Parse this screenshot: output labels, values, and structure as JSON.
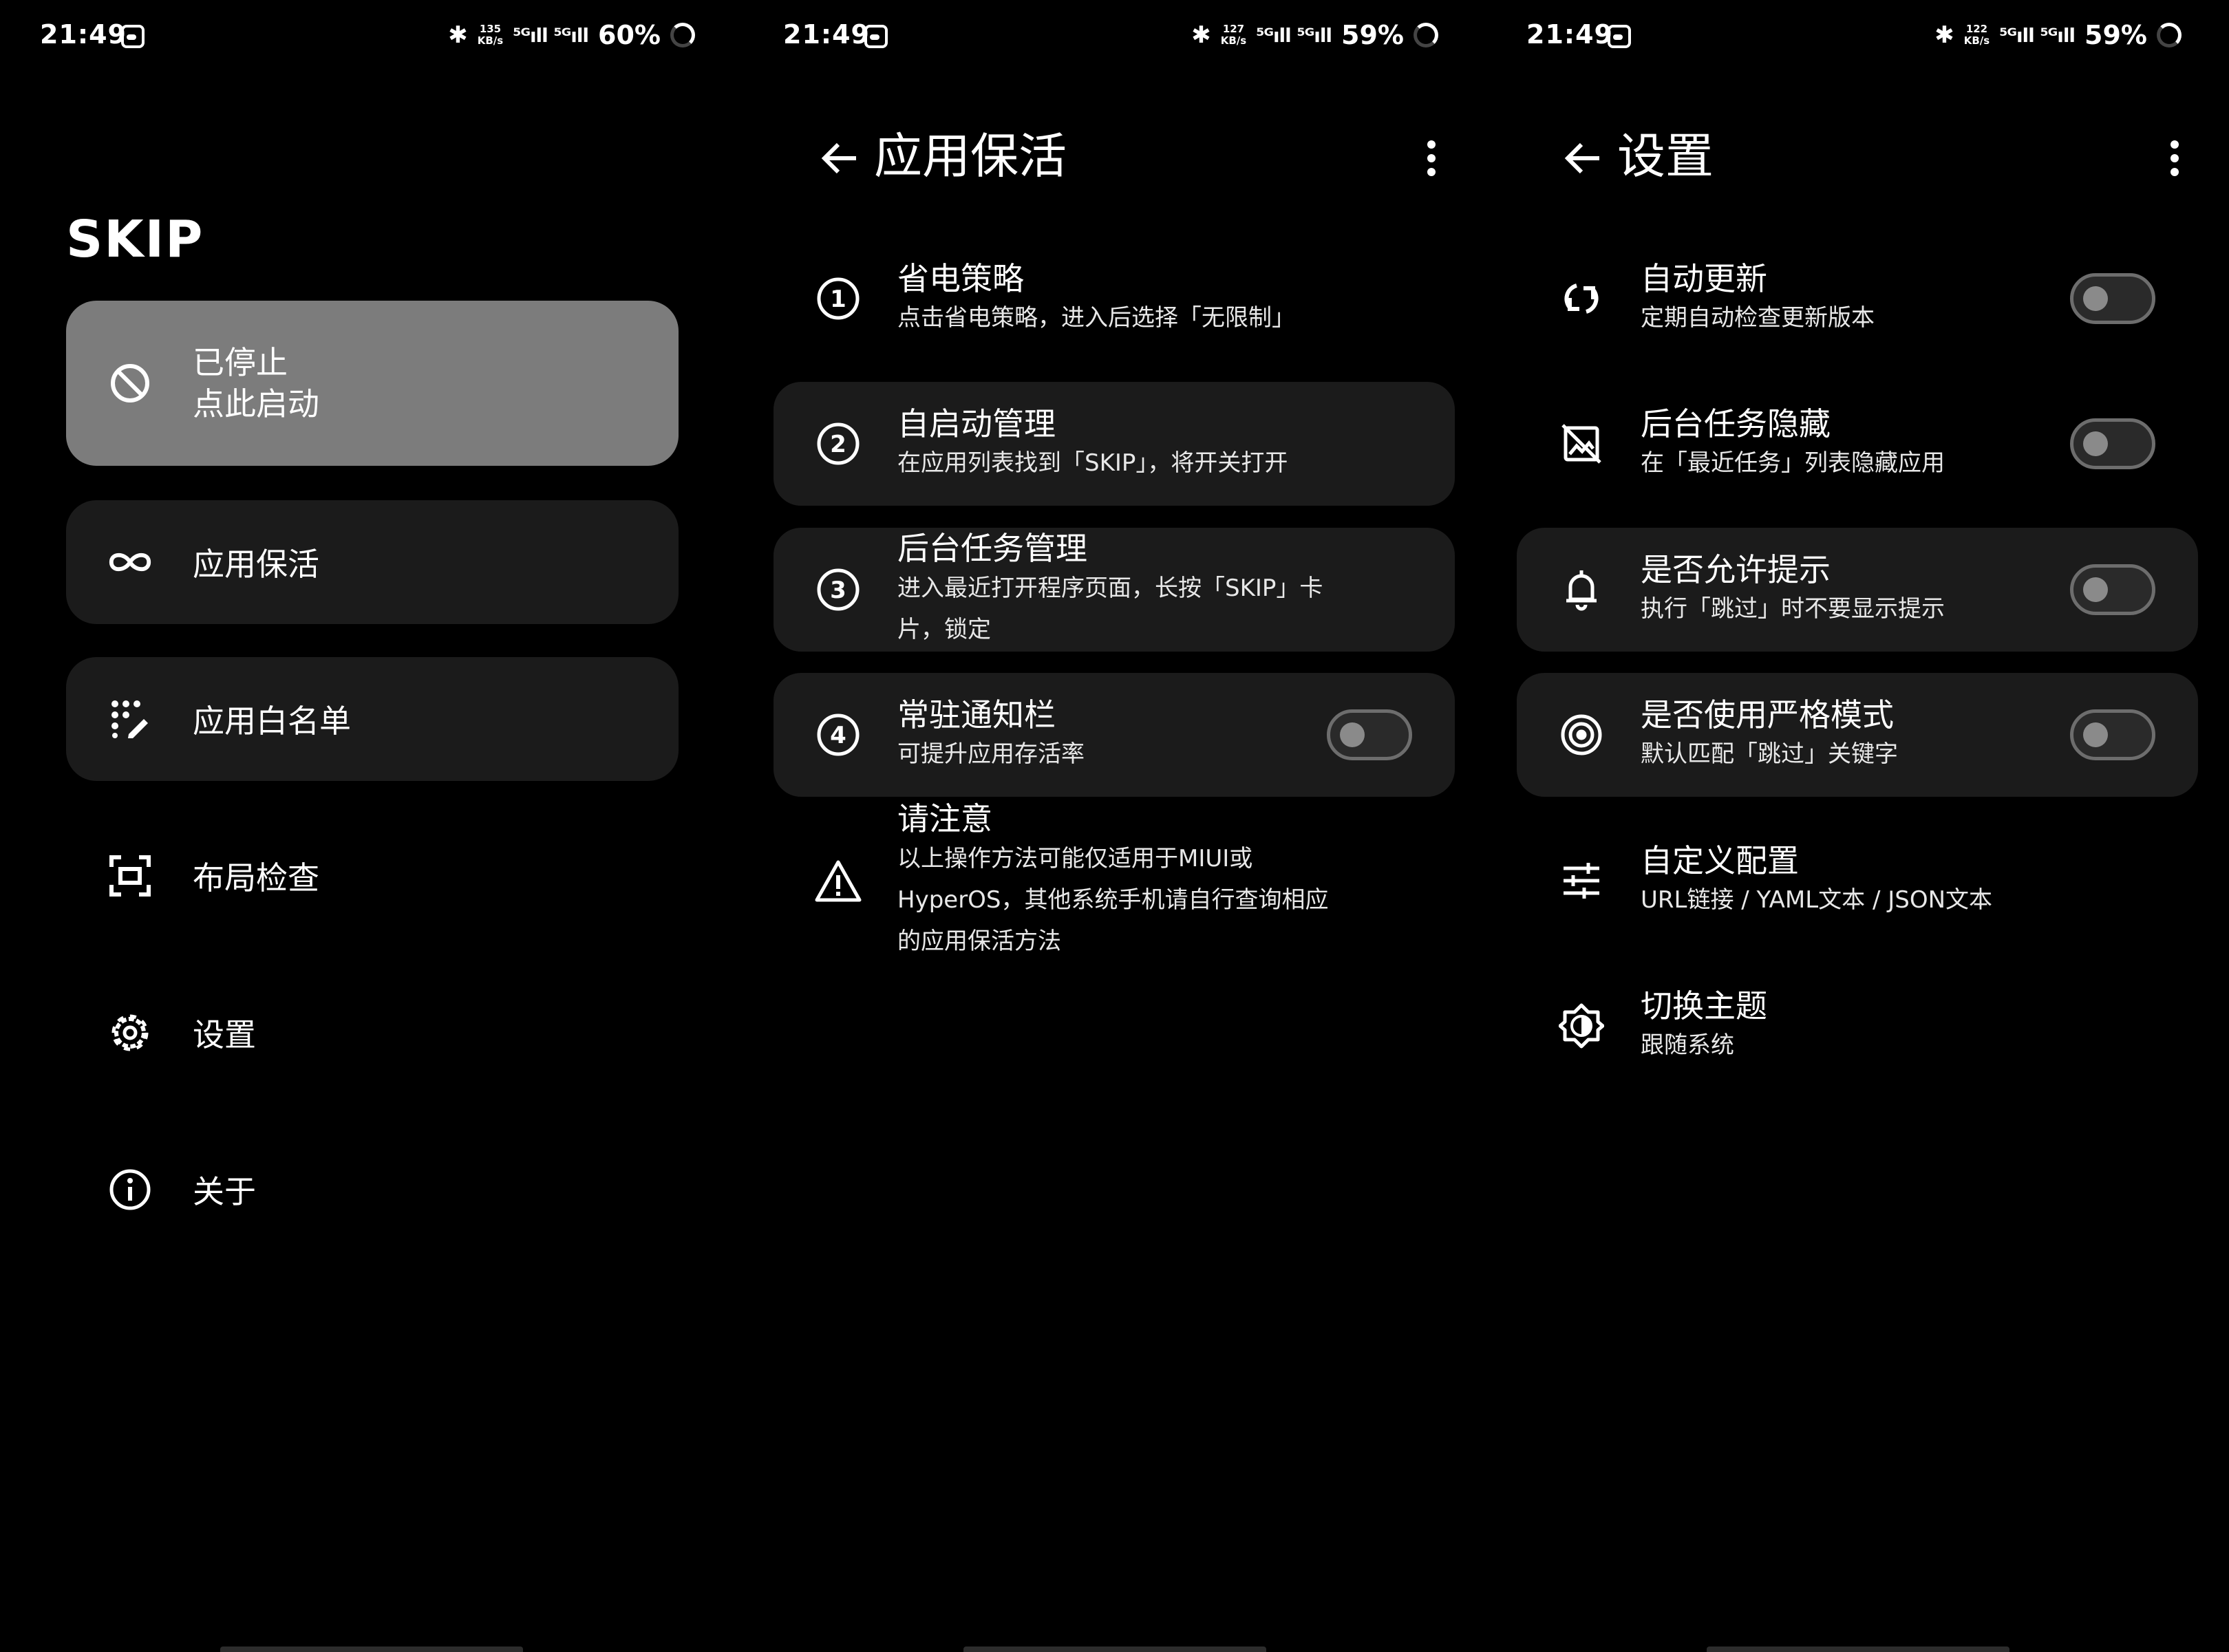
{
  "screens": [
    {
      "status": {
        "time": "21:49",
        "speed_top": "135",
        "speed_unit": "KB/s",
        "signal": "⁵ᴳıll ⁵ᴳıll",
        "battery": "60%"
      },
      "app_title": "SKIP",
      "primary_card": {
        "line1": "已停止",
        "line2": "点此启动",
        "icon": "block-icon"
      },
      "menu": [
        {
          "label": "应用保活",
          "icon": "infinity-icon"
        },
        {
          "label": "应用白名单",
          "icon": "dots-edit-icon"
        },
        {
          "label": "布局检查",
          "icon": "focus-frame-icon"
        },
        {
          "label": "设置",
          "icon": "gear-icon"
        },
        {
          "label": "关于",
          "icon": "info-icon"
        }
      ]
    },
    {
      "status": {
        "time": "21:49",
        "speed_top": "127",
        "speed_unit": "KB/s",
        "signal": "⁵ᴳıll ⁵ᴳıll",
        "battery": "59%"
      },
      "title": "应用保活",
      "rows": [
        {
          "title": "省电策略",
          "subtitle": "点击省电策略，进入后选择「无限制」",
          "icon": "number-1-icon"
        },
        {
          "title": "自启动管理",
          "subtitle": "在应用列表找到「SKIP」，将开关打开",
          "icon": "number-2-icon"
        },
        {
          "title": "后台任务管理",
          "subtitle": "进入最近打开程序页面，长按「SKIP」卡片，锁定",
          "icon": "number-3-icon"
        },
        {
          "title": "常驻通知栏",
          "subtitle": "可提升应用存活率",
          "icon": "number-4-icon",
          "toggle": false
        },
        {
          "title": "请注意",
          "subtitle": "以上操作方法可能仅适用于MIUI或HyperOS，其他系统手机请自行查询相应的应用保活方法",
          "icon": "warning-icon"
        }
      ]
    },
    {
      "status": {
        "time": "21:49",
        "speed_top": "122",
        "speed_unit": "KB/s",
        "signal": "⁵ᴳıll ⁵ᴳıll",
        "battery": "59%"
      },
      "title": "设置",
      "rows": [
        {
          "title": "自动更新",
          "subtitle": "定期自动检查更新版本",
          "icon": "sync-icon",
          "toggle": false
        },
        {
          "title": "后台任务隐藏",
          "subtitle": "在「最近任务」列表隐藏应用",
          "icon": "hide-image-icon",
          "toggle": false
        },
        {
          "title": "是否允许提示",
          "subtitle": "执行「跳过」时不要显示提示",
          "icon": "bell-icon",
          "toggle": false
        },
        {
          "title": "是否使用严格模式",
          "subtitle": "默认匹配「跳过」关键字",
          "icon": "target-icon",
          "toggle": false
        },
        {
          "title": "自定义配置",
          "subtitle": "URL链接 / YAML文本 / JSON文本",
          "icon": "sliders-icon"
        },
        {
          "title": "切换主题",
          "subtitle": "跟随系统",
          "icon": "brightness-icon"
        }
      ]
    }
  ]
}
